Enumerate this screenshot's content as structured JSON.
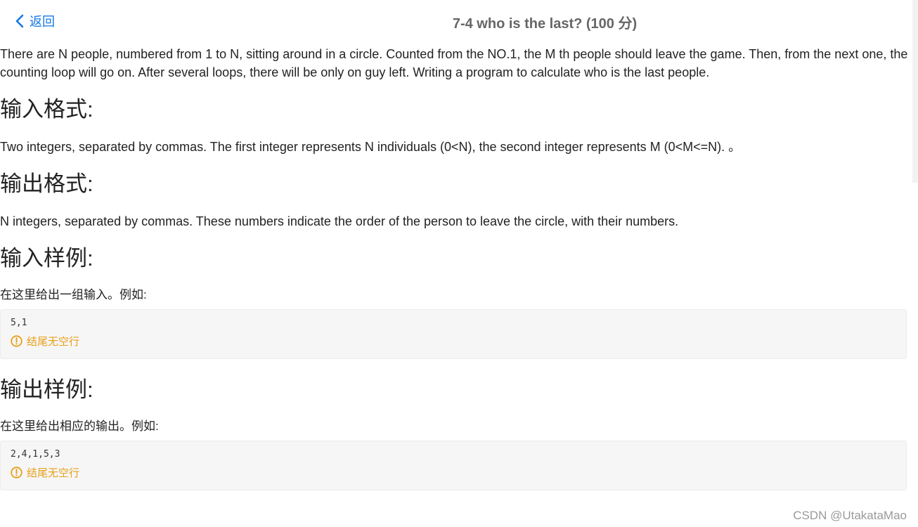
{
  "header": {
    "back_label": "返回",
    "title": "7-4 who is the last? (100 分)"
  },
  "problem": {
    "description": "There are N people, numbered from 1 to N, sitting around in a circle. Counted from the NO.1, the M th people should leave the game. Then, from the next one, the counting loop will go on. After several loops, there will be only on guy left. Writing a program to calculate who is the last people.",
    "input_format_heading": "输入格式:",
    "input_format_text": "Two integers, separated by commas. The first integer represents N individuals (0<N), the second integer represents M (0<M<=N). 。",
    "output_format_heading": "输出格式:",
    "output_format_text": "N integers, separated by commas. These numbers indicate the order of the person to leave the circle, with their numbers.",
    "sample_input_heading": "输入样例:",
    "sample_input_note": "在这里给出一组输入。例如:",
    "sample_input_code": "5,1",
    "sample_input_warning": "结尾无空行",
    "sample_output_heading": "输出样例:",
    "sample_output_note": "在这里给出相应的输出。例如:",
    "sample_output_code": "2,4,1,5,3",
    "sample_output_warning": "结尾无空行"
  },
  "watermark": "CSDN @UtakataMao",
  "colors": {
    "link": "#1677e5",
    "warning": "#e8a01b",
    "code_bg": "#f6f6f6"
  }
}
